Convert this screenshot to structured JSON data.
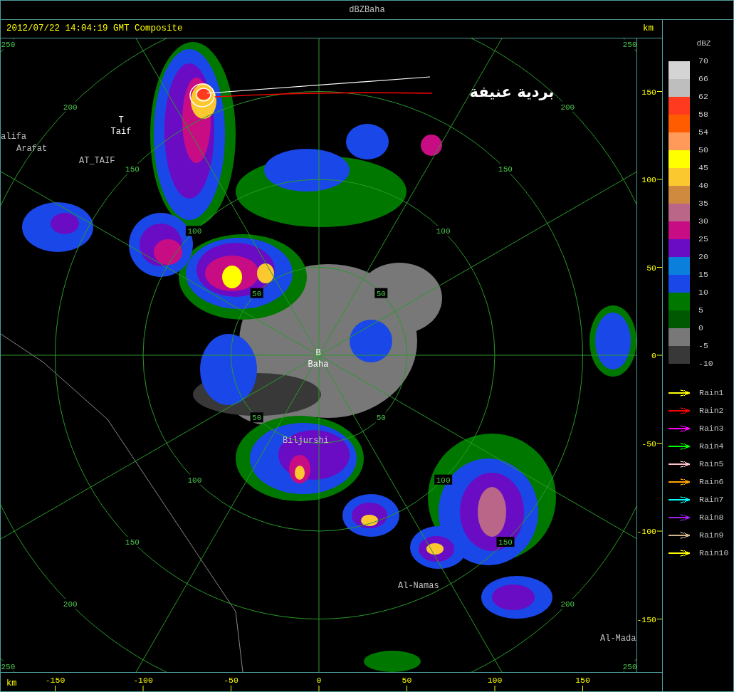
{
  "window": {
    "title": "dBZBaha"
  },
  "header": {
    "timestamp": "2012/07/22 14:04:19 GMT Composite",
    "unit": "km"
  },
  "map": {
    "range_rings": [
      {
        "labels": [
          "50",
          "50",
          "50",
          "50"
        ]
      },
      {
        "labels": [
          "100",
          "100",
          "100",
          "100"
        ]
      },
      {
        "labels": [
          "150",
          "150",
          "150",
          "150"
        ]
      },
      {
        "labels": [
          "200",
          "200",
          "200",
          "200"
        ]
      },
      {
        "labels": [
          "250",
          "250",
          "250",
          "250"
        ]
      }
    ],
    "places": [
      {
        "marker": "T",
        "name": "Taif",
        "kind": "station"
      },
      {
        "name": "alifa",
        "kind": "town"
      },
      {
        "name": "Arafat",
        "kind": "town"
      },
      {
        "name": "AT_TAIF",
        "kind": "town"
      },
      {
        "marker": "B",
        "name": "Baha",
        "kind": "station"
      },
      {
        "name": "Biljurshi",
        "kind": "town"
      },
      {
        "name": "Al-Namas",
        "kind": "town"
      },
      {
        "name": "Al-Mada",
        "kind": "town"
      }
    ],
    "annotation": "بردية عنيفة"
  },
  "y_axis": {
    "ticks": [
      "150",
      "100",
      "50",
      "0",
      "-50",
      "-100",
      "-150"
    ]
  },
  "x_axis": {
    "unit": "km",
    "ticks": [
      "-150",
      "-100",
      "-50",
      "0",
      "50",
      "100",
      "150"
    ]
  },
  "legend": {
    "title": "dBZ",
    "bins": [
      {
        "label": "70",
        "color": "#d4d4d4"
      },
      {
        "label": "66",
        "color": "#bebebe"
      },
      {
        "label": "62",
        "color": "#ff3a1e"
      },
      {
        "label": "58",
        "color": "#ff5c00"
      },
      {
        "label": "54",
        "color": "#ff9a5a"
      },
      {
        "label": "50",
        "color": "#ffff00"
      },
      {
        "label": "45",
        "color": "#fcc830"
      },
      {
        "label": "40",
        "color": "#d08a40"
      },
      {
        "label": "35",
        "color": "#ba6688"
      },
      {
        "label": "30",
        "color": "#c80c84"
      },
      {
        "label": "25",
        "color": "#6a0cc4"
      },
      {
        "label": "20",
        "color": "#0a80dc"
      },
      {
        "label": "15",
        "color": "#1a48e8"
      },
      {
        "label": "10",
        "color": "#007800"
      },
      {
        "label": "5",
        "color": "#005800"
      },
      {
        "label": "0",
        "color": "#787878"
      },
      {
        "label": "-5",
        "color": "#383838"
      }
    ],
    "bottom_label": "-10"
  },
  "tracks": [
    {
      "name": "Rain1",
      "color": "#ffff00"
    },
    {
      "name": "Rain2",
      "color": "#ff0000"
    },
    {
      "name": "Rain3",
      "color": "#ff00ff"
    },
    {
      "name": "Rain4",
      "color": "#00ff00"
    },
    {
      "name": "Rain5",
      "color": "#ffc0cb"
    },
    {
      "name": "Rain6",
      "color": "#ffa500"
    },
    {
      "name": "Rain7",
      "color": "#00ffff"
    },
    {
      "name": "Rain8",
      "color": "#a020f0"
    },
    {
      "name": "Rain9",
      "color": "#d2b48c"
    },
    {
      "name": "Rain10",
      "color": "#ffff00"
    }
  ]
}
